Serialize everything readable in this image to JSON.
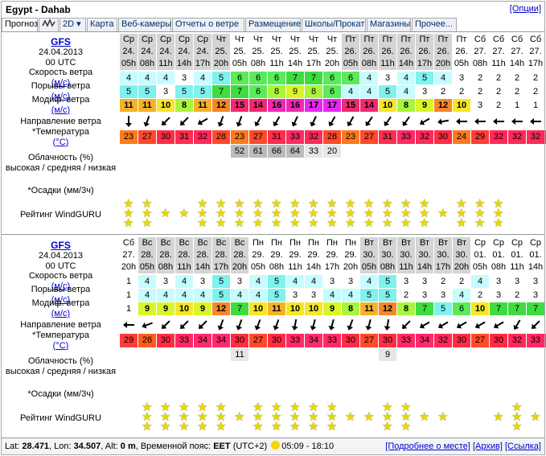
{
  "header": {
    "location": "Egypt - Dahab",
    "options_link": "[Опции]"
  },
  "tabs": [
    {
      "label": "Прогноз",
      "active": true
    },
    {
      "label": "graph-icon",
      "icon": true
    },
    {
      "label": "2D ▾"
    },
    {
      "label": "Карта"
    },
    {
      "label": "Веб-камеры"
    },
    {
      "label": "Отчеты о ветре"
    },
    {
      "label": "Размещение"
    },
    {
      "label": "Школы/Прокат"
    },
    {
      "label": "Магазины"
    },
    {
      "label": "Прочее..."
    }
  ],
  "labels": {
    "model": "GFS",
    "date": "24.04.2013",
    "time": "00 UTC",
    "wind_speed": "Скорость ветра",
    "gusts": "Порывы ветра",
    "modified": "Модиф. ветра",
    "unit_ms": "(м/с)",
    "direction": "Направление ветра",
    "temp": "*Температура",
    "unit_c": "(°C)",
    "cloud1": "Облачность (%)",
    "cloud2": "высокая / средняя / низкая",
    "precip": "*Осадки (мм/3ч)",
    "rating": "Рейтинг WindGURU"
  },
  "blocks": [
    {
      "days": [
        "Ср",
        "Ср",
        "Ср",
        "Ср",
        "Ср",
        "Чт",
        "Чт",
        "Чт",
        "Чт",
        "Чт",
        "Чт",
        "Чт",
        "Пт",
        "Пт",
        "Пт",
        "Пт",
        "Пт",
        "Пт",
        "Пт",
        "Сб",
        "Сб",
        "Сб",
        "Сб"
      ],
      "dates": [
        "24.",
        "24.",
        "24.",
        "24.",
        "24.",
        "25.",
        "25.",
        "25.",
        "25.",
        "25.",
        "25.",
        "25.",
        "26.",
        "26.",
        "26.",
        "26.",
        "26.",
        "26.",
        "26.",
        "27.",
        "27.",
        "27.",
        "27."
      ],
      "hours": [
        "05h",
        "08h",
        "11h",
        "14h",
        "17h",
        "20h",
        "05h",
        "08h",
        "11h",
        "14h",
        "17h",
        "20h",
        "05h",
        "08h",
        "11h",
        "14h",
        "17h",
        "20h",
        "05h",
        "08h",
        "11h",
        "14h",
        "17h",
        "20h"
      ],
      "speed": [
        "4",
        "4",
        "4",
        "3",
        "4",
        "5",
        "6",
        "6",
        "6",
        "7",
        "7",
        "6",
        "6",
        "4",
        "3",
        "4",
        "5",
        "4",
        "3",
        "2",
        "2",
        "2",
        "2",
        "2"
      ],
      "gusts": [
        "5",
        "5",
        "3",
        "5",
        "5",
        "7",
        "7",
        "6",
        "8",
        "9",
        "8",
        "6",
        "4",
        "4",
        "5",
        "4",
        "3",
        "2",
        "2",
        "2",
        "2",
        "2",
        "2",
        "2"
      ],
      "modified": [
        "11",
        "11",
        "10",
        "8",
        "11",
        "12",
        "15",
        "14",
        "16",
        "16",
        "17",
        "17",
        "15",
        "14",
        "10",
        "8",
        "9",
        "12",
        "10",
        "3",
        "2",
        "1",
        "1",
        "1"
      ],
      "direction_deg": [
        0,
        20,
        45,
        45,
        60,
        20,
        20,
        30,
        30,
        25,
        25,
        30,
        30,
        35,
        35,
        35,
        60,
        80,
        90,
        90,
        90,
        90,
        90,
        90
      ],
      "temp": [
        "23",
        "27",
        "30",
        "31",
        "32",
        "28",
        "23",
        "27",
        "31",
        "33",
        "32",
        "28",
        "23",
        "27",
        "31",
        "33",
        "32",
        "30",
        "24",
        "29",
        "32",
        "32",
        "32",
        "32"
      ],
      "cloud": [
        "",
        "",
        "",
        "",
        "",
        "",
        "52",
        "61",
        "66",
        "64",
        "33",
        "20",
        "",
        "",
        "",
        "",
        "",
        "",
        "",
        "",
        "",
        "",
        "",
        ""
      ],
      "stars": [
        2,
        2,
        1,
        1,
        2,
        2,
        2,
        2,
        2,
        2,
        2,
        2,
        2,
        2,
        2,
        2,
        2,
        1,
        2,
        2,
        2,
        0,
        0,
        0
      ]
    },
    {
      "days": [
        "Сб",
        "Вс",
        "Вс",
        "Вс",
        "Вс",
        "Вс",
        "Вс",
        "Пн",
        "Пн",
        "Пн",
        "Пн",
        "Пн",
        "Пн",
        "Вт",
        "Вт",
        "Вт",
        "Вт",
        "Вт",
        "Вт",
        "Ср",
        "Ср",
        "Ср",
        "Ср"
      ],
      "dates": [
        "27.",
        "28.",
        "28.",
        "28.",
        "28.",
        "28.",
        "28.",
        "29.",
        "29.",
        "29.",
        "29.",
        "29.",
        "29.",
        "30.",
        "30.",
        "30.",
        "30.",
        "30.",
        "30.",
        "01.",
        "01.",
        "01.",
        "01."
      ],
      "hours": [
        "20h",
        "05h",
        "08h",
        "11h",
        "14h",
        "17h",
        "20h",
        "05h",
        "08h",
        "11h",
        "14h",
        "17h",
        "20h",
        "05h",
        "08h",
        "11h",
        "14h",
        "17h",
        "20h",
        "05h",
        "08h",
        "11h",
        "14h",
        "17h"
      ],
      "speed": [
        "1",
        "4",
        "3",
        "4",
        "3",
        "5",
        "3",
        "4",
        "5",
        "4",
        "4",
        "3",
        "3",
        "4",
        "5",
        "3",
        "3",
        "2",
        "2",
        "4",
        "3",
        "3",
        "3",
        "3"
      ],
      "gusts": [
        "1",
        "4",
        "4",
        "4",
        "4",
        "5",
        "4",
        "4",
        "5",
        "3",
        "3",
        "4",
        "4",
        "5",
        "5",
        "2",
        "3",
        "3",
        "4",
        "2",
        "3",
        "2",
        "3",
        "2"
      ],
      "modified": [
        "1",
        "9",
        "9",
        "10",
        "9",
        "12",
        "7",
        "10",
        "11",
        "10",
        "10",
        "9",
        "8",
        "11",
        "12",
        "8",
        "7",
        "5",
        "6",
        "10",
        "7",
        "7",
        "7",
        "3"
      ],
      "direction_deg": [
        90,
        70,
        45,
        45,
        45,
        20,
        20,
        20,
        20,
        10,
        15,
        15,
        20,
        15,
        10,
        45,
        60,
        60,
        60,
        60,
        60,
        30,
        45,
        60
      ],
      "temp": [
        "29",
        "26",
        "30",
        "33",
        "34",
        "34",
        "30",
        "27",
        "30",
        "33",
        "34",
        "33",
        "30",
        "27",
        "30",
        "33",
        "34",
        "32",
        "30",
        "27",
        "30",
        "32",
        "33",
        "34"
      ],
      "cloud": [
        "",
        "",
        "",
        "",
        "",
        "",
        "11",
        "",
        "",
        "",
        "",
        "",
        "",
        "",
        "9",
        "",
        "",
        "",
        "",
        "",
        "",
        "",
        "",
        ""
      ],
      "stars": [
        0,
        2,
        2,
        2,
        2,
        2,
        1,
        2,
        2,
        2,
        2,
        2,
        1,
        1,
        2,
        2,
        1,
        1,
        0,
        0,
        1,
        2,
        1,
        1
      ]
    }
  ],
  "footer": {
    "lat_label": "Lat: ",
    "lat": "28.471",
    "lon_label": ", Lon: ",
    "lon": "34.507",
    "alt_label": ", Alt: ",
    "alt": "0 m",
    "tz_label": ", Временной пояс: ",
    "tz": "EET",
    "tz_offset": "(UTC+2)",
    "sun": "05:09 - 18:10",
    "links": [
      "[Подробнее о месте]",
      "[Архив]",
      "[Ссылка]"
    ]
  },
  "colors": {
    "speed": {
      "1": "#ffffff",
      "2": "#ffffff",
      "3": "#ffffff",
      "4": "#c6fcff",
      "5": "#7ff2ee",
      "6": "#5aeb5a",
      "7": "#3fdc3f",
      "8": "#a8f53c",
      "9": "#d9f529",
      "10": "#f5e629",
      "11": "#f5b229",
      "12": "#f58629",
      "14": "#f02a6e",
      "15": "#f02a6e",
      "16": "#f028b4",
      "17": "#e628f0"
    },
    "temp": {
      "23": "#ff7a1e",
      "24": "#ff7a1e",
      "26": "#ff5a1e",
      "27": "#ff4a2a",
      "28": "#ff4a2a",
      "29": "#ff3b3b",
      "30": "#ff2d44",
      "31": "#ff2d50",
      "32": "#ff2a5a",
      "33": "#ff2a64",
      "34": "#ff2a6e"
    }
  }
}
